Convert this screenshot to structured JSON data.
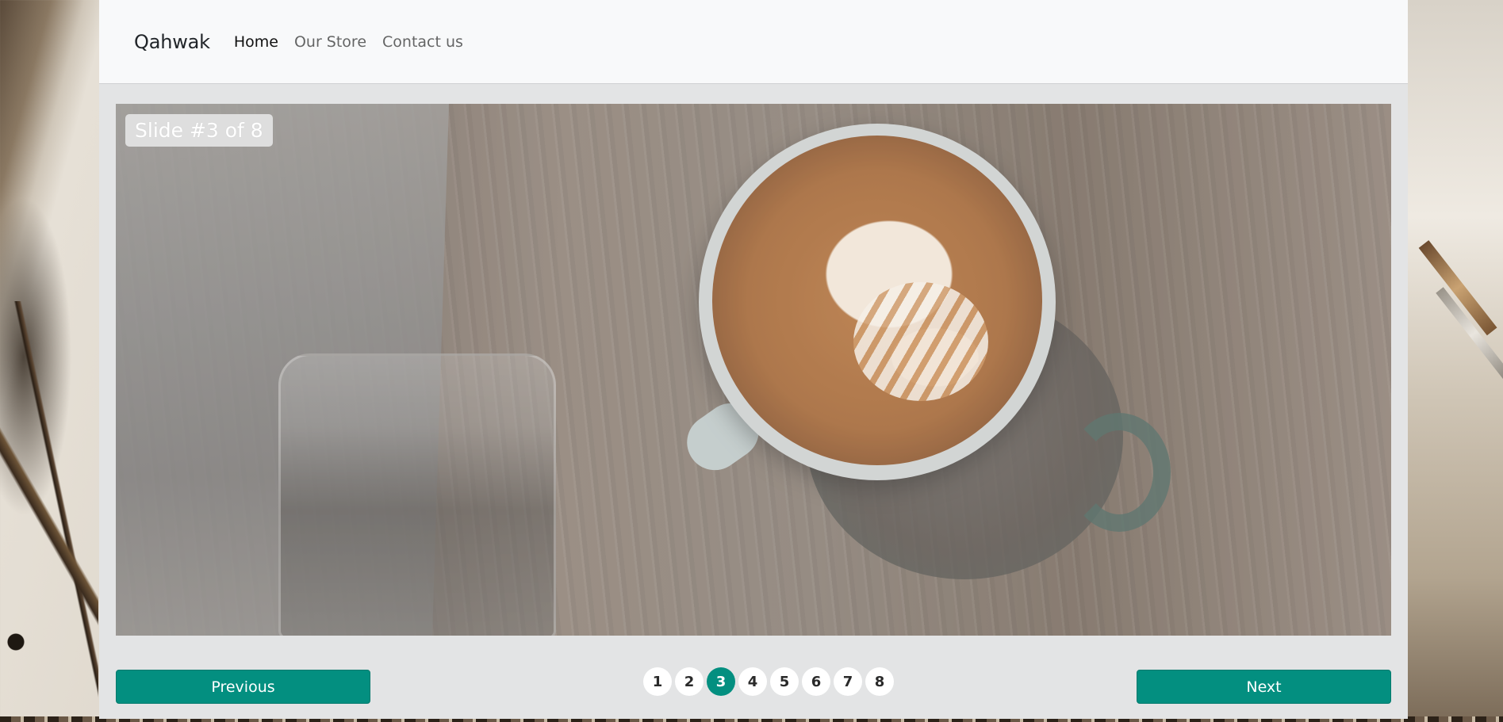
{
  "navbar": {
    "brand": "Qahwak",
    "links": [
      {
        "label": "Home",
        "active": true
      },
      {
        "label": "Our Store",
        "active": false
      },
      {
        "label": "Contact us",
        "active": false
      }
    ]
  },
  "carousel": {
    "caption": "Slide #3 of 8",
    "current_slide": 3,
    "total_slides": 8,
    "indicators": [
      "1",
      "2",
      "3",
      "4",
      "5",
      "6",
      "7",
      "8"
    ],
    "previous_label": "Previous",
    "next_label": "Next"
  },
  "colors": {
    "accent": "#038f80",
    "navbar_bg": "#f8f9fa",
    "card_bg": "#e3e4e5"
  }
}
